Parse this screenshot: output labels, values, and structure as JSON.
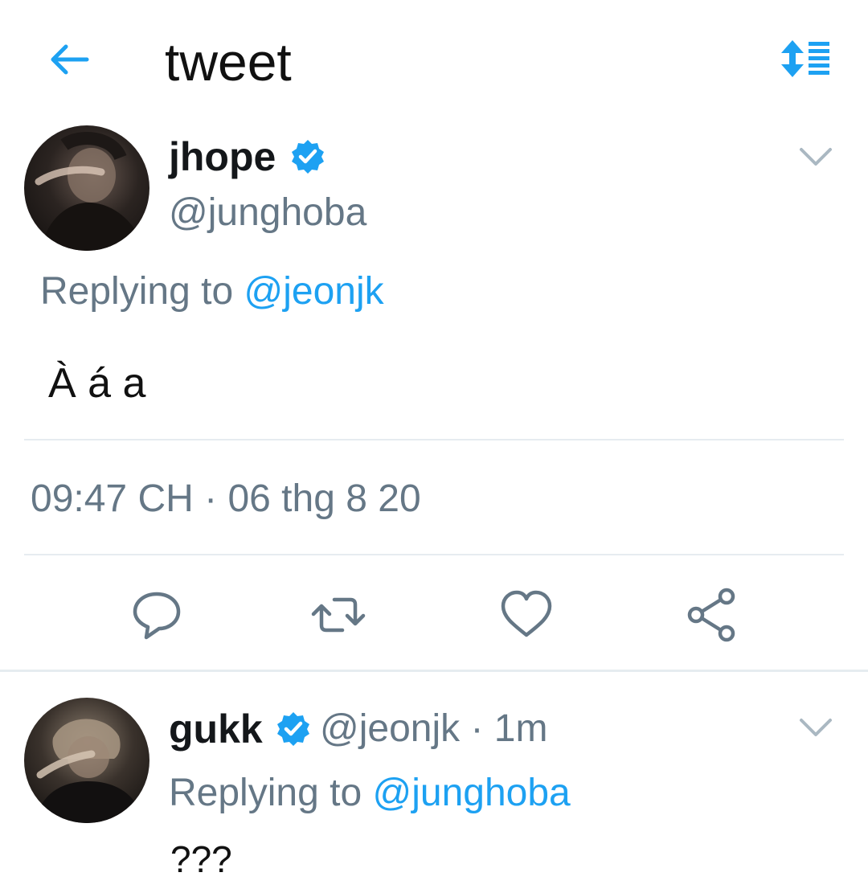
{
  "header": {
    "title": "tweet",
    "back_icon": "arrow-left-icon",
    "sort_icon": "sort-order-icon"
  },
  "colors": {
    "accent": "#1da1f2",
    "muted": "#657786",
    "text": "#14171a",
    "divider": "#e6ecf0"
  },
  "tweet": {
    "name": "jhope",
    "handle": "@junghoba",
    "replying_prefix": "Replying to",
    "replying_to": "@jeonjk",
    "text": "À á a",
    "timestamp": "09:47 CH · 06 thg 8 20",
    "actions": [
      "reply-icon",
      "retweet-icon",
      "like-icon",
      "share-icon"
    ]
  },
  "reply": {
    "name": "gukk",
    "handle_time": "@jeonjk · 1m",
    "replying_prefix": "Replying to",
    "replying_to": "@junghoba",
    "text": "???"
  }
}
